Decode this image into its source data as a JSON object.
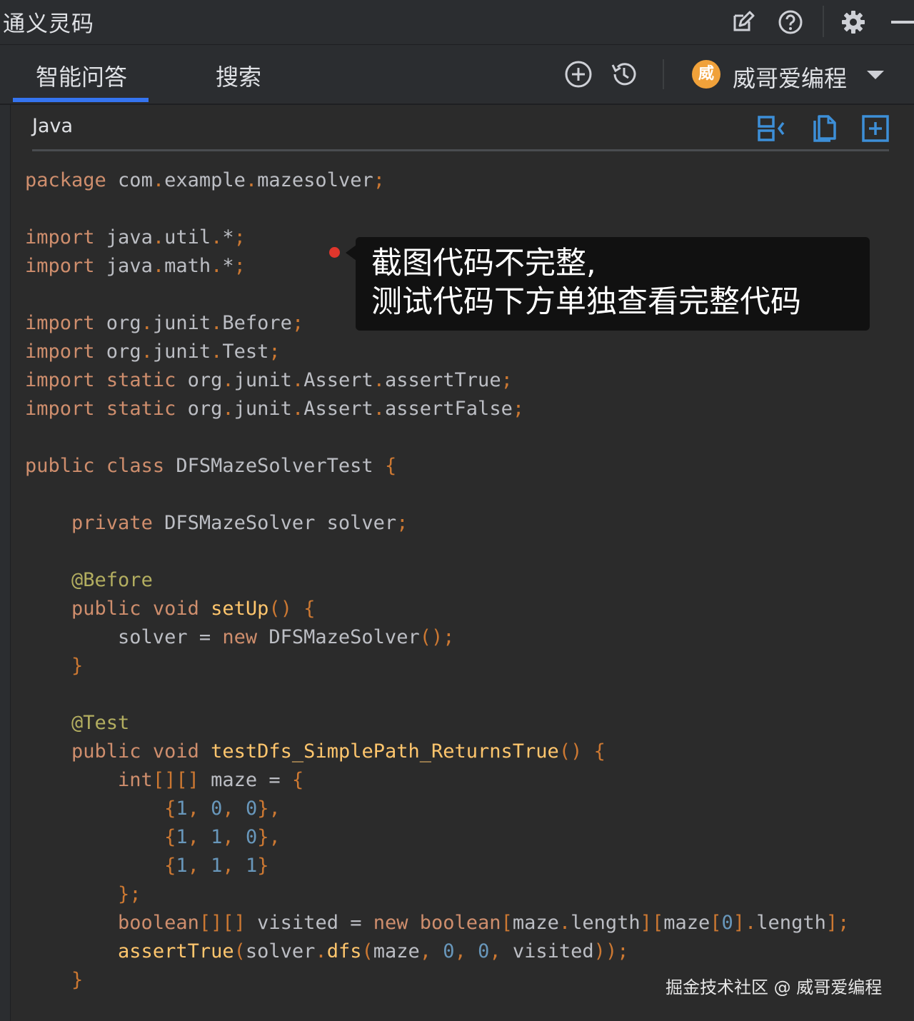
{
  "app": {
    "title": "通义灵码"
  },
  "titlebar_icons": [
    "edit-icon",
    "help-icon",
    "gear-icon",
    "minimize-icon"
  ],
  "tabs": [
    {
      "label": "智能问答",
      "active": true
    },
    {
      "label": "搜索",
      "active": false
    }
  ],
  "toolbar_icons": [
    "new-chat-icon",
    "history-icon"
  ],
  "user": {
    "avatar_text": "威",
    "name": "威哥爱编程",
    "avatar_color": "#f0a13a"
  },
  "code_block": {
    "language": "Java",
    "actions": [
      "insert-code-icon",
      "copy-icon",
      "new-file-icon"
    ],
    "lines": [
      "package com.example.mazesolver;",
      "",
      "import java.util.*;",
      "import java.math.*;",
      "",
      "import org.junit.Before;",
      "import org.junit.Test;",
      "import static org.junit.Assert.assertTrue;",
      "import static org.junit.Assert.assertFalse;",
      "",
      "public class DFSMazeSolverTest {",
      "",
      "    private DFSMazeSolver solver;",
      "",
      "    @Before",
      "    public void setUp() {",
      "        solver = new DFSMazeSolver();",
      "    }",
      "",
      "    @Test",
      "    public void testDfs_SimplePath_ReturnsTrue() {",
      "        int[][] maze = {",
      "            {1, 0, 0},",
      "            {1, 1, 0},",
      "            {1, 1, 1}",
      "        };",
      "        boolean[][] visited = new boolean[maze.length][maze[0].length];",
      "        assertTrue(solver.dfs(maze, 0, 0, visited));",
      "    }"
    ]
  },
  "annotation": {
    "line1": "截图代码不完整,",
    "line2": "测试代码下方单独查看完整代码"
  },
  "watermark": "掘金技术社区 @ 威哥爱编程",
  "colors": {
    "accent": "#3574f0",
    "keyword": "#cf8e6d",
    "annotation": "#b3ae60",
    "number": "#6897bb",
    "method": "#ffc66d",
    "plain": "#bcbec4"
  }
}
